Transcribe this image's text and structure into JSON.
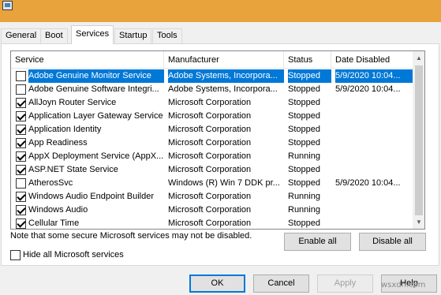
{
  "window": {
    "icon": "msconfig-app-icon"
  },
  "tabs": [
    {
      "label": "General",
      "active": false
    },
    {
      "label": "Boot",
      "active": false
    },
    {
      "label": "Services",
      "active": true
    },
    {
      "label": "Startup",
      "active": false
    },
    {
      "label": "Tools",
      "active": false
    }
  ],
  "columns": [
    "Service",
    "Manufacturer",
    "Status",
    "Date Disabled"
  ],
  "services": [
    {
      "name": "Adobe Genuine Monitor Service",
      "manufacturer": "Adobe Systems, Incorpora...",
      "status": "Stopped",
      "date_disabled": "5/9/2020 10:04...",
      "checked": false,
      "selected": true
    },
    {
      "name": "Adobe Genuine Software Integri...",
      "manufacturer": "Adobe Systems, Incorpora...",
      "status": "Stopped",
      "date_disabled": "5/9/2020 10:04...",
      "checked": false,
      "selected": false
    },
    {
      "name": "AllJoyn Router Service",
      "manufacturer": "Microsoft Corporation",
      "status": "Stopped",
      "date_disabled": "",
      "checked": true,
      "selected": false
    },
    {
      "name": "Application Layer Gateway Service",
      "manufacturer": "Microsoft Corporation",
      "status": "Stopped",
      "date_disabled": "",
      "checked": true,
      "selected": false
    },
    {
      "name": "Application Identity",
      "manufacturer": "Microsoft Corporation",
      "status": "Stopped",
      "date_disabled": "",
      "checked": true,
      "selected": false
    },
    {
      "name": "App Readiness",
      "manufacturer": "Microsoft Corporation",
      "status": "Stopped",
      "date_disabled": "",
      "checked": true,
      "selected": false
    },
    {
      "name": "AppX Deployment Service (AppX...",
      "manufacturer": "Microsoft Corporation",
      "status": "Running",
      "date_disabled": "",
      "checked": true,
      "selected": false
    },
    {
      "name": "ASP.NET State Service",
      "manufacturer": "Microsoft Corporation",
      "status": "Stopped",
      "date_disabled": "",
      "checked": true,
      "selected": false
    },
    {
      "name": "AtherosSvc",
      "manufacturer": "Windows (R) Win 7 DDK pr...",
      "status": "Stopped",
      "date_disabled": "5/9/2020 10:04...",
      "checked": false,
      "selected": false
    },
    {
      "name": "Windows Audio Endpoint Builder",
      "manufacturer": "Microsoft Corporation",
      "status": "Running",
      "date_disabled": "",
      "checked": true,
      "selected": false
    },
    {
      "name": "Windows Audio",
      "manufacturer": "Microsoft Corporation",
      "status": "Running",
      "date_disabled": "",
      "checked": true,
      "selected": false
    },
    {
      "name": "Cellular Time",
      "manufacturer": "Microsoft Corporation",
      "status": "Stopped",
      "date_disabled": "",
      "checked": true,
      "selected": false
    }
  ],
  "note": "Note that some secure Microsoft services may not be disabled.",
  "buttons": {
    "enable_all": "Enable all",
    "disable_all": "Disable all",
    "ok": "OK",
    "cancel": "Cancel",
    "apply": "Apply",
    "help": "Help"
  },
  "hide_ms_services": {
    "label": "Hide all Microsoft services",
    "checked": false
  },
  "watermark": "wsxdn.com",
  "colors": {
    "titlebar": "#e8a33c",
    "selection": "#0078d7",
    "default_button_border": "#0078d7"
  }
}
